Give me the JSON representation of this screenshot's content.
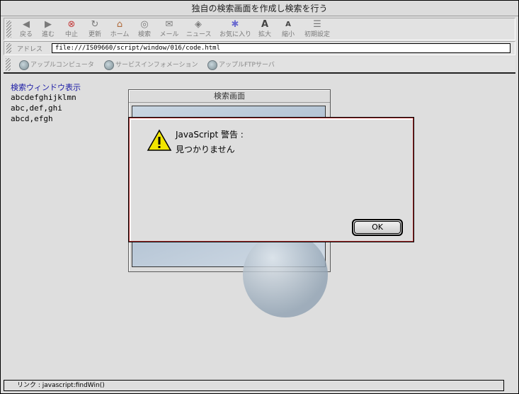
{
  "window": {
    "title": "独自の検索画面を作成し検索を行う"
  },
  "toolbar": {
    "buttons": [
      {
        "label": "戻る",
        "icon": "back-arrow-icon",
        "glyph": "◆"
      },
      {
        "label": "進む",
        "icon": "forward-arrow-icon",
        "glyph": "◆"
      },
      {
        "label": "中止",
        "icon": "stop-icon",
        "glyph": "⊗"
      },
      {
        "label": "更新",
        "icon": "refresh-icon",
        "glyph": "↻"
      },
      {
        "label": "ホーム",
        "icon": "home-icon",
        "glyph": "⌂"
      },
      {
        "label": "検索",
        "icon": "search-icon",
        "glyph": "◎"
      },
      {
        "label": "メール",
        "icon": "mail-icon",
        "glyph": "✉"
      },
      {
        "label": "ニュース",
        "icon": "news-icon",
        "glyph": "◈"
      },
      {
        "label": "お気に入り",
        "icon": "favorites-icon",
        "glyph": "✱"
      },
      {
        "label": "拡大",
        "icon": "text-larger-icon",
        "glyph": "A"
      },
      {
        "label": "縮小",
        "icon": "text-smaller-icon",
        "glyph": "A"
      },
      {
        "label": "初期設定",
        "icon": "preferences-icon",
        "glyph": "☰"
      }
    ]
  },
  "address": {
    "label": "アドレス",
    "value": "file:///IS09660/script/window/016/code.html"
  },
  "favorites": [
    {
      "label": "アップルコンピュータ"
    },
    {
      "label": "サービスインフォメーション"
    },
    {
      "label": "アップルFTPサーバ"
    }
  ],
  "page": {
    "link": "検索ウィンドウ表示",
    "lines": [
      "abcdefghijklmn",
      "abc,def,ghi",
      "abcd,efgh"
    ]
  },
  "search_window": {
    "title": "検索画面"
  },
  "dialog": {
    "title": "JavaScript 警告 :",
    "message": "見つかりません",
    "ok_label": "OK"
  },
  "status": {
    "text": "リンク : javascript:findWin()"
  },
  "colors": {
    "link": "#1a1aa6",
    "warning_yellow": "#f2e600",
    "dialog_border": "#b03030"
  }
}
